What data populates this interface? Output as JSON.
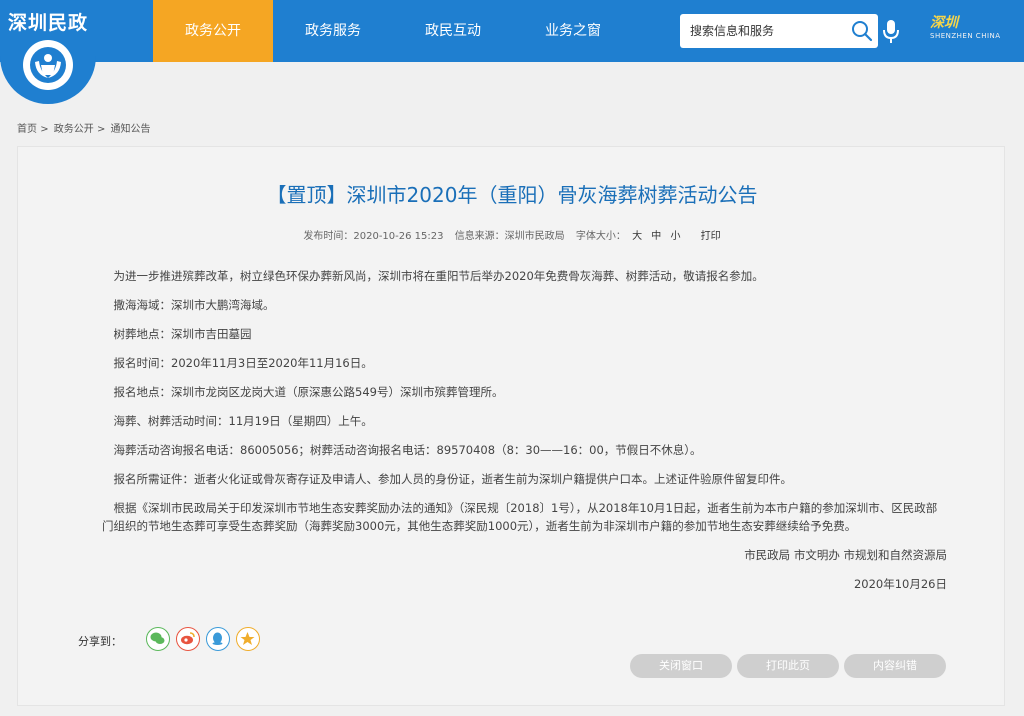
{
  "header": {
    "logo_text": "深圳民政",
    "nav": [
      {
        "label": "政务公开",
        "active": true
      },
      {
        "label": "政务服务",
        "active": false
      },
      {
        "label": "政民互动",
        "active": false
      },
      {
        "label": "业务之窗",
        "active": false
      }
    ],
    "search_placeholder": "搜索信息和服务",
    "brand_logo_text": "深圳",
    "brand_logo_sub": "SHENZHEN CHINA"
  },
  "breadcrumb": [
    "首页",
    "政务公开",
    "通知公告"
  ],
  "breadcrumb_sep": ">",
  "article": {
    "title": "【置顶】深圳市2020年（重阳）骨灰海葬树葬活动公告",
    "meta": {
      "publish_time": "发布时间：2020-10-26 15:23",
      "source": "信息来源：深圳市民政局",
      "font_size_label": "字体大小：",
      "font_sizes": [
        "大",
        "中",
        "小"
      ],
      "print": "打印"
    },
    "paragraphs": [
      "为进一步推进殡葬改革，树立绿色环保办葬新风尚，深圳市将在重阳节后举办2020年免费骨灰海葬、树葬活动，敬请报名参加。",
      "撒海海域：深圳市大鹏湾海域。",
      "树葬地点：深圳市吉田墓园",
      "报名时间：2020年11月3日至2020年11月16日。",
      "报名地点：深圳市龙岗区龙岗大道（原深惠公路549号）深圳市殡葬管理所。",
      "海葬、树葬活动时间：11月19日（星期四）上午。",
      "海葬活动咨询报名电话：86005056；树葬活动咨询报名电话：89570408（8：30——16：00，节假日不休息）。",
      "报名所需证件：逝者火化证或骨灰寄存证及申请人、参加人员的身份证，逝者生前为深圳户籍提供户口本。上述证件验原件留复印件。",
      "根据《深圳市民政局关于印发深圳市节地生态安葬奖励办法的通知》（深民规〔2018〕1号），从2018年10月1日起，逝者生前为本市户籍的参加深圳市、区民政部门组织的节地生态葬可享受生态葬奖励（海葬奖励3000元，其他生态葬奖励1000元），逝者生前为非深圳市户籍的参加节地生态安葬继续给予免费。"
    ],
    "signature": "市民政局  市文明办  市规划和自然资源局",
    "date": "2020年10月26日"
  },
  "share": {
    "label": "分享到：",
    "icons": [
      {
        "name": "wechat-icon",
        "color": "#5bb85b"
      },
      {
        "name": "weibo-icon",
        "color": "#e8543f"
      },
      {
        "name": "qq-icon",
        "color": "#3a9ad9"
      },
      {
        "name": "qzone-icon",
        "color": "#f0ad2c"
      }
    ]
  },
  "buttons": {
    "close": "关闭窗口",
    "print": "打印此页",
    "correct": "内容纠错"
  }
}
